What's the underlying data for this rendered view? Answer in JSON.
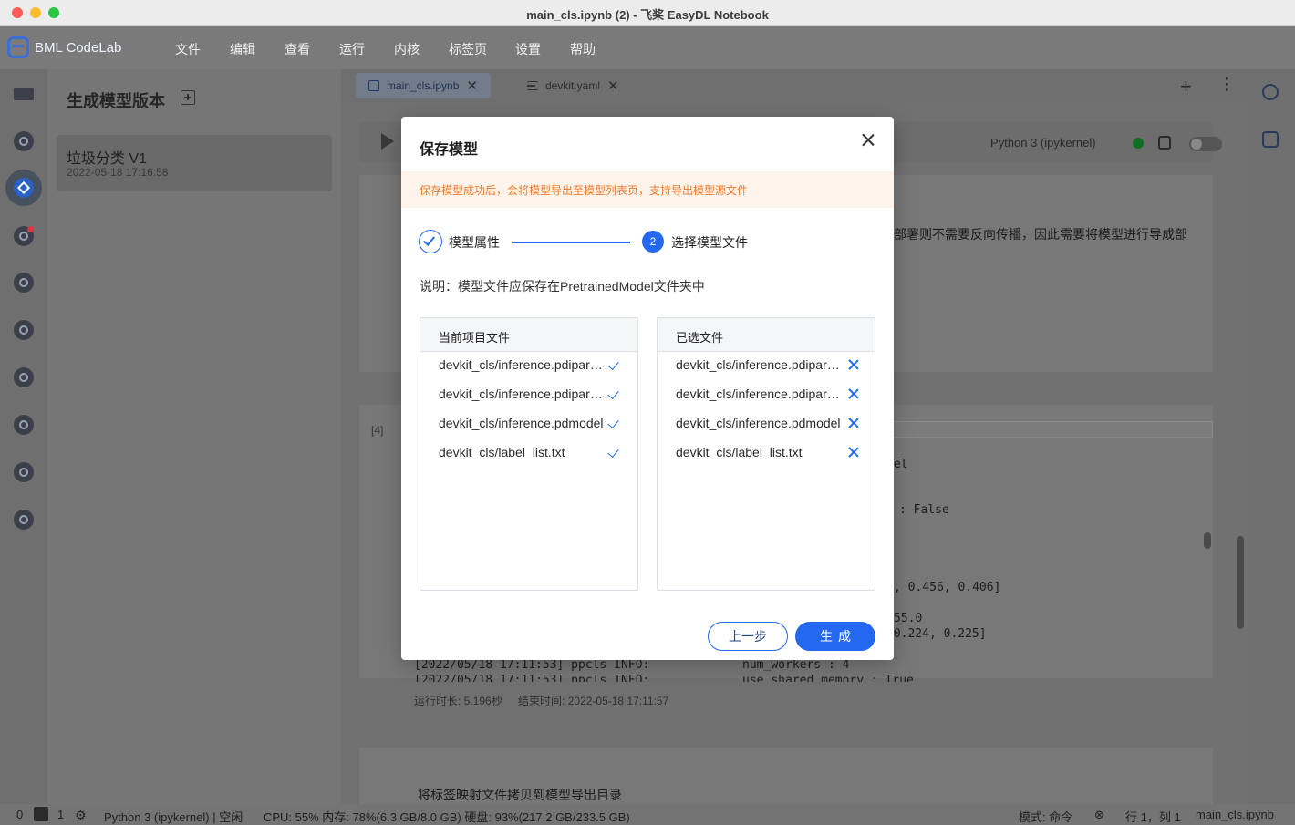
{
  "window": {
    "title": "main_cls.ipynb (2) - 飞桨 EasyDL Notebook"
  },
  "app": {
    "brand": "BML CodeLab"
  },
  "menu": [
    "文件",
    "编辑",
    "查看",
    "运行",
    "内核",
    "标签页",
    "设置",
    "帮助"
  ],
  "sidepanel": {
    "title": "生成模型版本",
    "version": {
      "name": "垃圾分类 V1",
      "date": "2022-05-18 17:16:58"
    }
  },
  "tabs": [
    {
      "label": "main_cls.ipynb",
      "icon": "notebook-icon"
    },
    {
      "label": "devkit.yaml",
      "icon": "text-file-icon"
    }
  ],
  "toolbar": {
    "kernel": "Python 3 (ipykernel)"
  },
  "notebook": {
    "md_fragment": "部署则不需要反向传播，因此需要将模型进行导成部",
    "cell_number": "[4]",
    "code_fragment": "del",
    "output_lines": [
      ": False",
      ", 0.456, 0.406]",
      "55.0",
      " 0.224, 0.225]",
      "[2022/05/18 17:11:53] ppcls INFO:             num_workers : 4",
      "[2022/05/18 17:11:53] ppcls INFO:             use_shared_memory : True"
    ],
    "run_duration": "运行时长:  5.196秒",
    "end_time": "结束时间:  2022-05-18 17:11:57",
    "next_md": "将标签映射文件拷贝到模型导出目录"
  },
  "statusbar": {
    "count1": "0",
    "count2": "1",
    "kernel_status": "Python 3 (ipykernel) | 空闲",
    "resources": "CPU:  55% 内存:  78%(6.3 GB/8.0 GB) 硬盘:  93%(217.2 GB/233.5 GB)",
    "mode": "模式:  命令",
    "position": "行 1，列 1",
    "filename": "main_cls.ipynb"
  },
  "modal": {
    "title": "保存模型",
    "notice": "保存模型成功后，会将模型导出至模型列表页，支持导出模型源文件",
    "steps": [
      {
        "label": "模型属性",
        "state": "done"
      },
      {
        "number": "2",
        "label": "选择模型文件",
        "state": "active"
      }
    ],
    "instruction": "说明：模型文件应保存在PretrainedModel文件夹中",
    "left_panel": {
      "header": "当前项目文件",
      "files": [
        "devkit_cls/inference.pdiparams",
        "devkit_cls/inference.pdiparams.info",
        "devkit_cls/inference.pdmodel",
        "devkit_cls/label_list.txt"
      ]
    },
    "right_panel": {
      "header": "已选文件",
      "files": [
        "devkit_cls/inference.pdiparams",
        "devkit_cls/inference.pdiparams.info",
        "devkit_cls/inference.pdmodel",
        "devkit_cls/label_list.txt"
      ]
    },
    "buttons": {
      "prev": "上一步",
      "generate": "生成"
    }
  },
  "colors": {
    "accent": "#2468f2",
    "notice_bg": "#fff4ec",
    "notice_text": "#f07a2a",
    "kernel_idle": "#0f6e1f"
  }
}
